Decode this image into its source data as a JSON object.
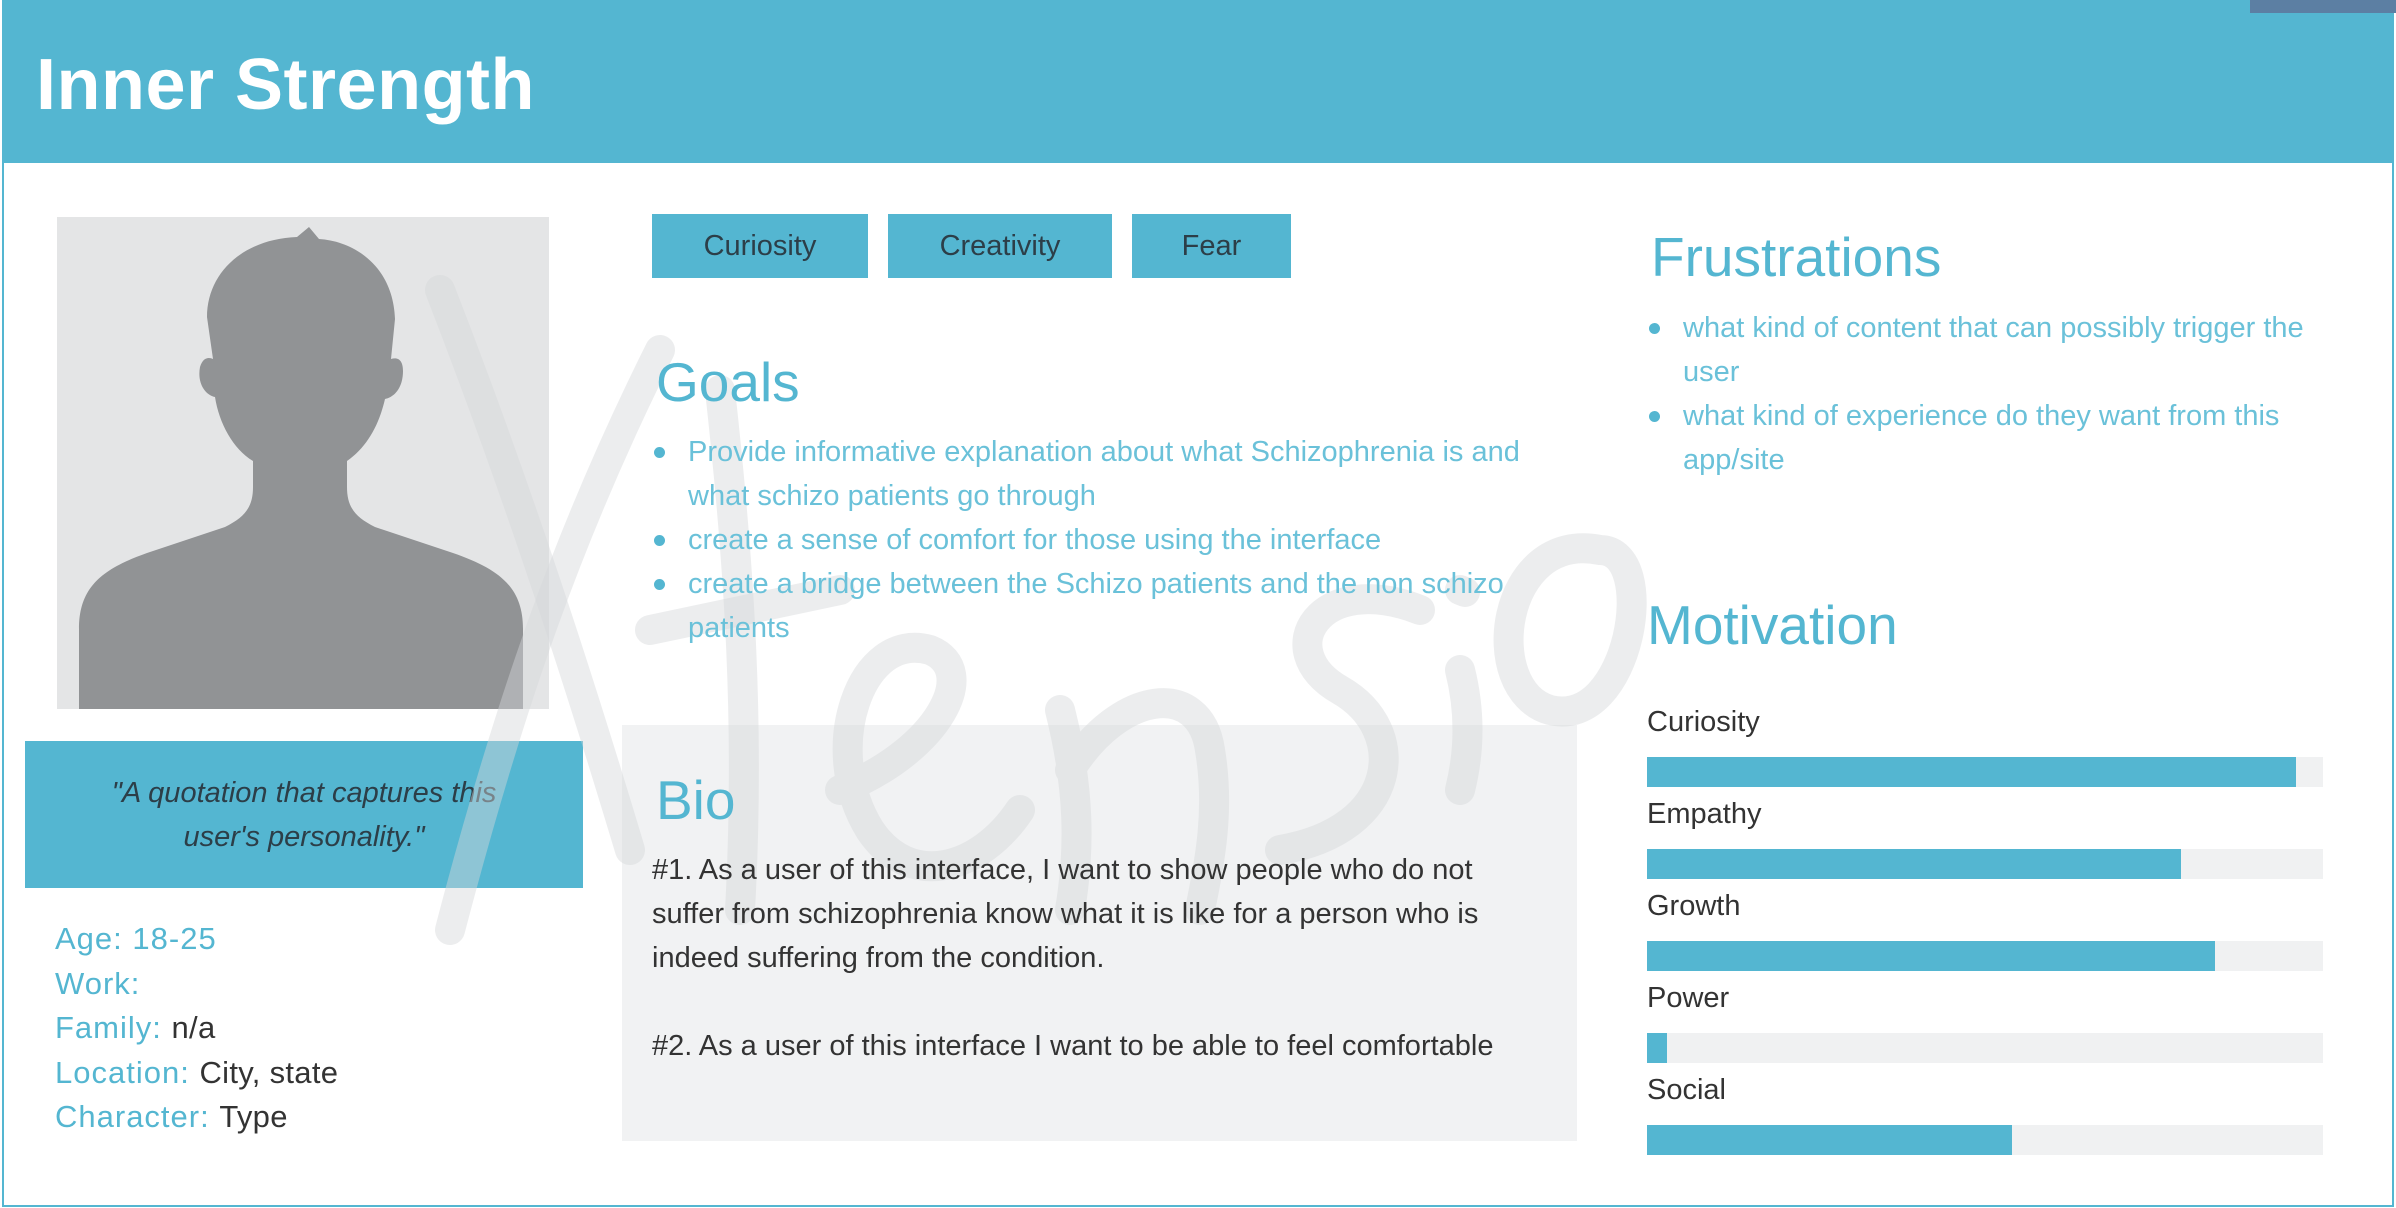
{
  "header": {
    "title": "Inner Strength"
  },
  "watermark": {
    "text": "Xtensio"
  },
  "profile": {
    "quote": "\"A quotation that captures this user's personality.\"",
    "details": [
      {
        "key": "Age:",
        "value": "18-25"
      },
      {
        "key": "Work:",
        "value": ""
      },
      {
        "key": "Family:",
        "value": "n/a"
      },
      {
        "key": "Location:",
        "value": "City, state"
      },
      {
        "key": "Character:",
        "value": "Type"
      }
    ]
  },
  "tags": [
    "Curiosity",
    "Creativity",
    "Fear"
  ],
  "goals": {
    "title": "Goals",
    "items": [
      "Provide informative explanation about what Schizophrenia is and what schizo patients go through",
      "create a sense of comfort for those using the interface",
      "create a bridge between the Schizo patients and the non schizo patients"
    ]
  },
  "bio": {
    "title": "Bio",
    "paragraphs": [
      "#1. As a user of this interface, I want to show people who do not suffer from schizophrenia know what it is like for a person who is indeed suffering from the condition.",
      "#2. As a user of this interface I want to be able to feel comfortable"
    ]
  },
  "frustrations": {
    "title": "Frustrations",
    "items": [
      "what kind of content that can possibly trigger the user",
      "what kind of experience do they want from this app/site"
    ]
  },
  "motivation": {
    "title": "Motivation",
    "items": [
      {
        "label": "Curiosity",
        "level": 0.96
      },
      {
        "label": "Empathy",
        "level": 0.79
      },
      {
        "label": "Growth",
        "level": 0.84
      },
      {
        "label": "Power",
        "level": 0.03
      },
      {
        "label": "Social",
        "level": 0.54
      }
    ]
  },
  "colors": {
    "accent": "#54b6d1",
    "track": "#f0f1f2",
    "avatar_bg": "#e4e5e6",
    "avatar_fg": "#919395"
  }
}
